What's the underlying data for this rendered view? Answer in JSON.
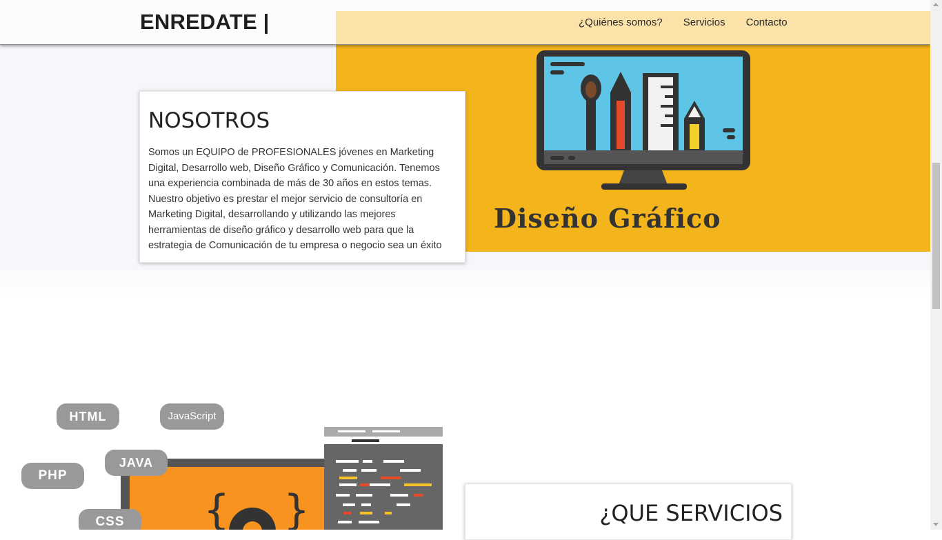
{
  "navbar": {
    "brand": "ENREDATE |",
    "links": [
      "¿Quiénes somos?",
      "Servicios",
      "Contacto"
    ]
  },
  "about": {
    "title": "NOSOTROS",
    "body": "Somos un EQUIPO de PROFESIONALES jóvenes en Marketing Digital, Desarrollo web, Diseño Gráfico y Comunicación. Tenemos una experiencia combinada de más de 30 años en estos temas. Nuestro objetivo es prestar el mejor servicio de consultoría en Marketing Digital, desarrollando y utilizando las mejores herramientas de diseño gráfico y desarrollo web para que la estrategia de Comunicación de tu empresa o negocio sea un éxito"
  },
  "design_illustration": {
    "caption": "Diseño Gráfico",
    "icon": "monitor-design-tools-icon"
  },
  "code_illustration": {
    "tags": [
      "HTML",
      "JavaScript",
      "PHP",
      "JAVA",
      "CSS"
    ],
    "icon": "web-development-icon"
  },
  "services": {
    "title": "¿QUE SERVICIOS"
  },
  "colors": {
    "accent_yellow": "#f4b41b",
    "monitor_screen": "#5ec5e6",
    "code_orange": "#f7931e"
  }
}
